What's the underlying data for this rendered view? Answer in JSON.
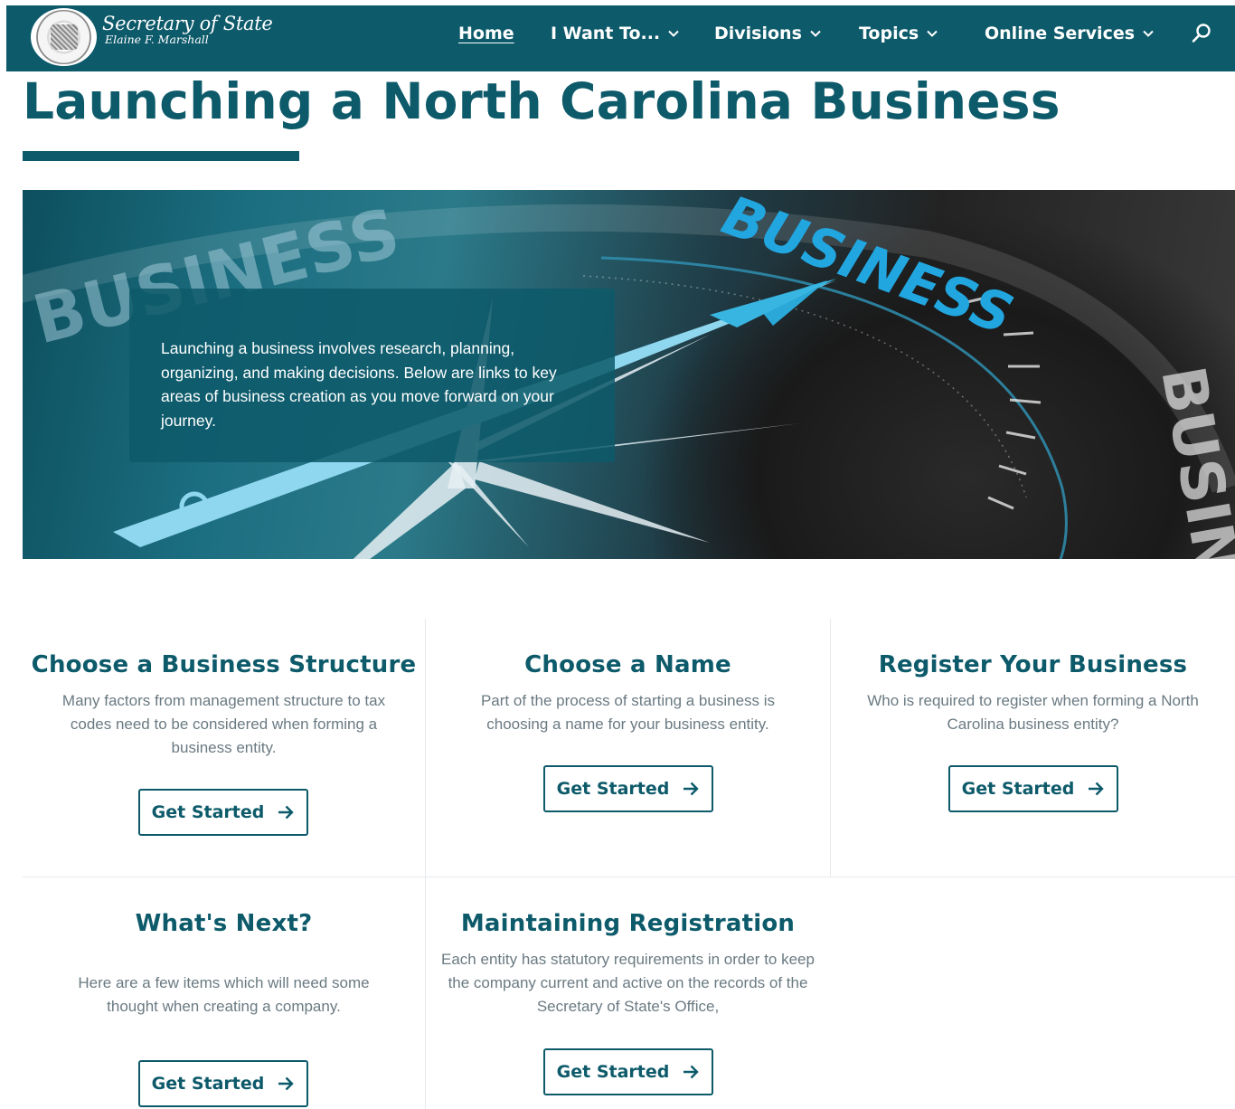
{
  "header": {
    "brand_title": "Secretary of State",
    "brand_subtitle": "Elaine F. Marshall",
    "nav": [
      {
        "label": "Home",
        "active": true,
        "has_dropdown": false
      },
      {
        "label": "I Want To...",
        "active": false,
        "has_dropdown": true
      },
      {
        "label": "Divisions",
        "active": false,
        "has_dropdown": true
      },
      {
        "label": "Topics",
        "active": false,
        "has_dropdown": true
      },
      {
        "label": "Online Services",
        "active": false,
        "has_dropdown": true
      }
    ],
    "search_icon": "search-icon",
    "background_color": "#0d5a6a"
  },
  "page": {
    "title": "Launching a North Carolina Business",
    "accent_color": "#0d5a6a"
  },
  "hero": {
    "intro_text": "Launching a business involves research, planning, organizing, and making decisions. Below are links to key areas of business creation as you move forward on your journey.",
    "image_words": [
      "BUSINESS",
      "BUSINESS",
      "BUSINESS"
    ]
  },
  "cards": [
    {
      "title": "Choose a Business Structure",
      "description": "Many factors from management structure to tax codes need to be considered when forming a business entity.",
      "button_label": "Get Started"
    },
    {
      "title": "Choose a Name",
      "description": "Part of the process of starting a business is choosing a name for your business entity.",
      "button_label": "Get Started"
    },
    {
      "title": "Register Your Business",
      "description": "Who is required to register when forming a North Carolina business entity?",
      "button_label": "Get Started"
    },
    {
      "title": "What's Next?",
      "description": "Here are a few items which will need some thought when creating a company.",
      "button_label": "Get Started"
    },
    {
      "title": "Maintaining Registration",
      "description": "Each entity has statutory requirements in order to keep the company current and active on the records of the Secretary of State's Office,",
      "button_label": "Get Started"
    }
  ]
}
